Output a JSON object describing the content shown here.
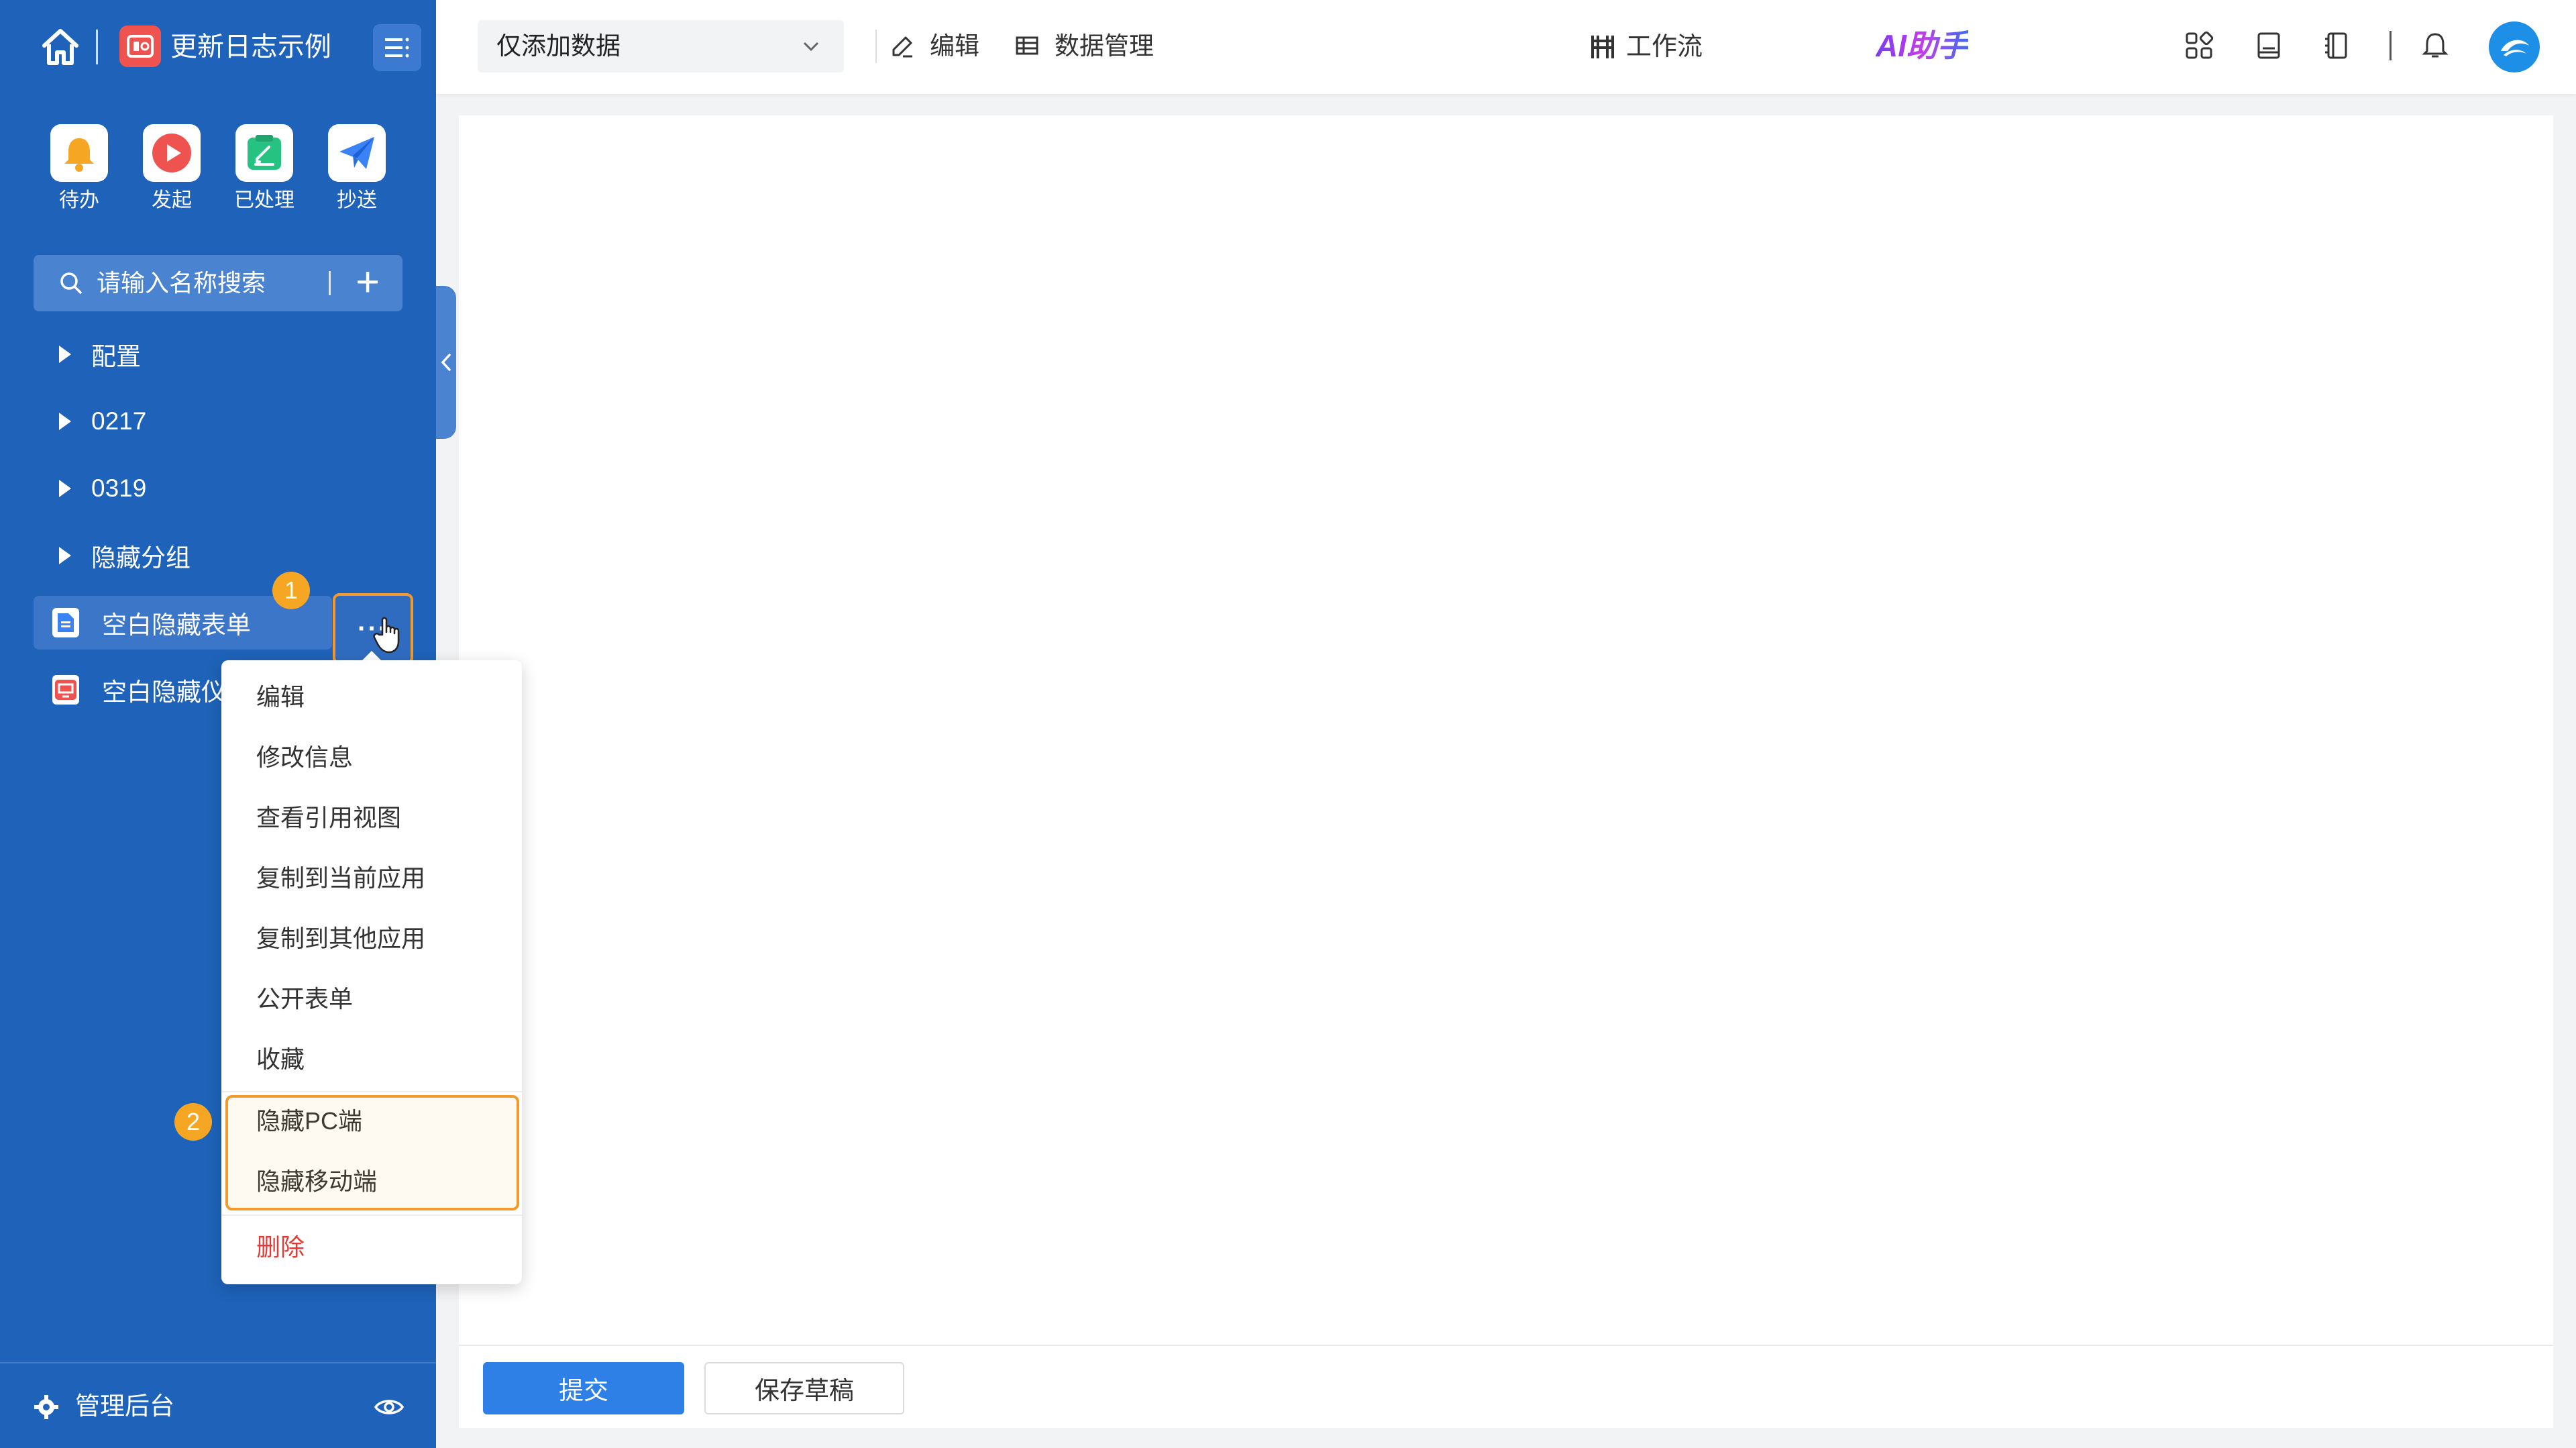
{
  "sidebar": {
    "app_title": "更新日志示例",
    "quick_actions": [
      {
        "label": "待办",
        "icon": "bell-icon",
        "color": "#f5a623"
      },
      {
        "label": "发起",
        "icon": "play-icon",
        "color": "#ef5350"
      },
      {
        "label": "已处理",
        "icon": "done-icon",
        "color": "#26c281"
      },
      {
        "label": "抄送",
        "icon": "send-icon",
        "color": "#3b82f6"
      }
    ],
    "search": {
      "placeholder": "请输入名称搜索"
    },
    "groups": [
      {
        "label": "配置"
      },
      {
        "label": "0217"
      },
      {
        "label": "0319"
      },
      {
        "label": "隐藏分组"
      }
    ],
    "items": [
      {
        "label": "空白隐藏表单",
        "icon": "form-doc-icon",
        "color": "#3b82f6"
      },
      {
        "label": "空白隐藏仪表",
        "icon": "dashboard-icon",
        "color": "#ef5350"
      }
    ],
    "more_button": "···",
    "admin_label": "管理后台"
  },
  "annotations": {
    "badge1": "1",
    "badge2": "2"
  },
  "topbar": {
    "mode_select_value": "仅添加数据",
    "edit_label": "编辑",
    "data_manage_label": "数据管理",
    "ai_label": "AI助手",
    "workflow_label": "工作流"
  },
  "context_menu": {
    "items": [
      "编辑",
      "修改信息",
      "查看引用视图",
      "复制到当前应用",
      "复制到其他应用",
      "公开表单",
      "收藏"
    ],
    "hide_items": [
      "隐藏PC端",
      "隐藏移动端"
    ],
    "delete_label": "删除",
    "danger_color": "#e53935",
    "highlight_color": "#f39a2b"
  },
  "footer": {
    "submit_label": "提交",
    "draft_label": "保存草稿"
  },
  "colors": {
    "sidebar_bg": "#1e63b9",
    "primary": "#2f80e6"
  }
}
